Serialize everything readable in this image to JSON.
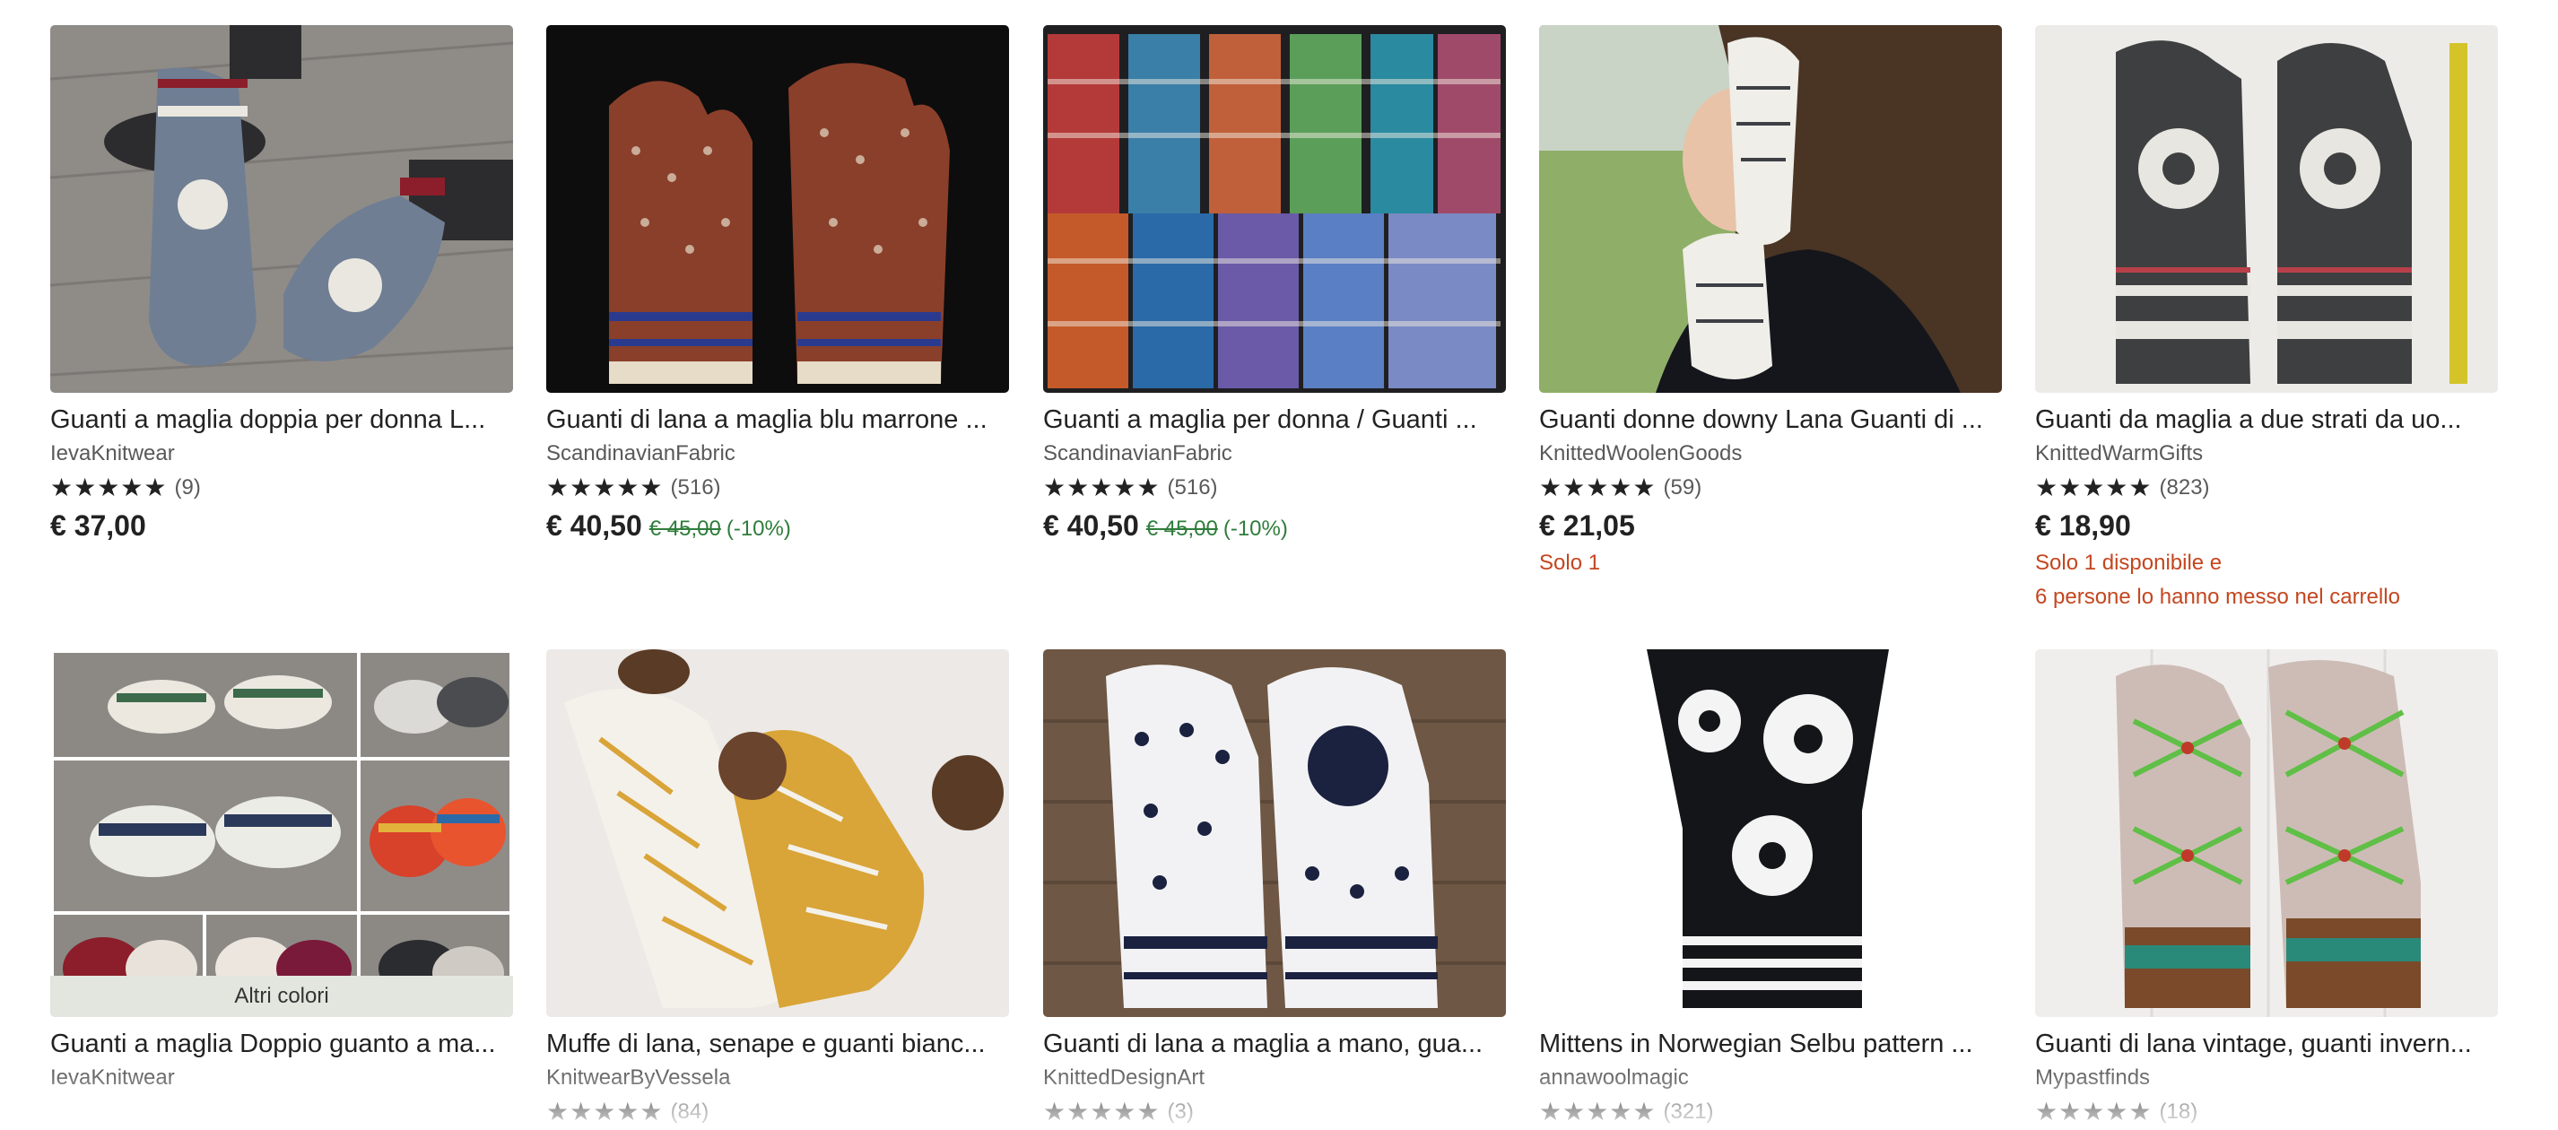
{
  "row1": [
    {
      "title": "Guanti a maglia doppia per donna L...",
      "shop": "IevaKnitwear",
      "stars": "★★★★★",
      "count": "(9)",
      "price": "€ 37,00",
      "original": "",
      "discount": "",
      "note1": "",
      "note2": ""
    },
    {
      "title": "Guanti di lana a maglia blu marrone ...",
      "shop": "ScandinavianFabric",
      "stars": "★★★★★",
      "count": "(516)",
      "price": "€ 40,50",
      "original": "€ 45,00",
      "discount": "(-10%)",
      "note1": "",
      "note2": ""
    },
    {
      "title": "Guanti a maglia per donna / Guanti ...",
      "shop": "ScandinavianFabric",
      "stars": "★★★★★",
      "count": "(516)",
      "price": "€ 40,50",
      "original": "€ 45,00",
      "discount": "(-10%)",
      "note1": "",
      "note2": ""
    },
    {
      "title": "Guanti donne downy Lana Guanti di ...",
      "shop": "KnittedWoolenGoods",
      "stars": "★★★★★",
      "count": "(59)",
      "price": "€ 21,05",
      "original": "",
      "discount": "",
      "note1": "Solo 1",
      "note2": ""
    },
    {
      "title": "Guanti da maglia a due strati da uo...",
      "shop": "KnittedWarmGifts",
      "stars": "★★★★★",
      "count": "(823)",
      "price": "€ 18,90",
      "original": "",
      "discount": "",
      "note1": "Solo 1 disponibile e",
      "note2": "6 persone lo hanno messo nel carrello"
    }
  ],
  "row2": [
    {
      "title": "Guanti a maglia Doppio guanto a ma...",
      "shop": "IevaKnitwear",
      "stars": "",
      "count": "",
      "altri": "Altri colori"
    },
    {
      "title": "Muffe di lana, senape e guanti bianc...",
      "shop": "KnitwearByVessela",
      "stars": "★★★★★",
      "count": "(84)"
    },
    {
      "title": "Guanti di lana a maglia a mano, gua...",
      "shop": "KnittedDesignArt",
      "stars": "★★★★★",
      "count": "(3)"
    },
    {
      "title": "Mittens in Norwegian Selbu pattern ...",
      "shop": "annawoolmagic",
      "stars": "★★★★★",
      "count": "(321)"
    },
    {
      "title": "Guanti di lana vintage, guanti invern...",
      "shop": "Mypastfinds",
      "stars": "★★★★★",
      "count": "(18)"
    }
  ],
  "colors": {
    "sale": "#2f7d3b",
    "alert": "#c4461f",
    "muted": "#595959",
    "altri_bg": "#e3e6de"
  }
}
